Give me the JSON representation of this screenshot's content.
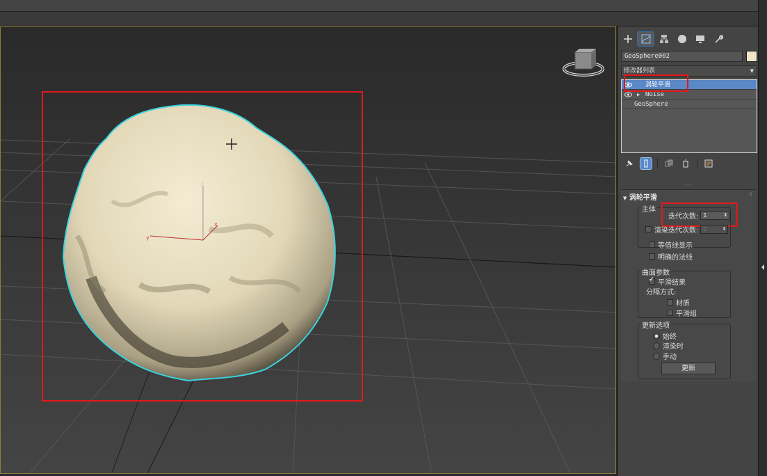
{
  "colors": {
    "highlight_red": "#e3181c",
    "selection_blue": "#5b88c6",
    "object_color": "#efe6c6",
    "wire_cyan": "#3ad3e0"
  },
  "viewport": {
    "cursor_icon": "crosshair-icon",
    "gizmo": {
      "axis_z": "z",
      "axis_x": "x",
      "axis_y": "y"
    },
    "viewcube_icon": "viewcube-icon"
  },
  "panel": {
    "tabs": [
      {
        "icon": "create-plus-icon"
      },
      {
        "icon": "modify-curve-icon"
      },
      {
        "icon": "hierarchy-icon"
      },
      {
        "icon": "motion-sphere-icon"
      },
      {
        "icon": "display-monitor-icon"
      },
      {
        "icon": "utilities-wrench-icon"
      }
    ],
    "object_name": "GeoSphere002",
    "modifier_list_label": "修改器列表",
    "stack": [
      {
        "label": "涡轮平滑",
        "selected": true
      },
      {
        "label": "Noise",
        "selected": false
      },
      {
        "label": "GeoSphere",
        "selected": false
      }
    ],
    "stack_tools": [
      "pin-stack-icon",
      "show-end-result-icon",
      "make-unique-icon",
      "remove-modifier-icon",
      "configure-sets-icon"
    ]
  },
  "rollout": {
    "title": "涡轮平滑",
    "main_group": "主体",
    "iterations_label": "迭代次数:",
    "iterations_value": "1",
    "render_iters_label": "渲染迭代次数:",
    "render_iters_value": "0",
    "isoline_label": "等值线显示",
    "explicit_normals_label": "明确的法线",
    "surface_group": "曲面参数",
    "smooth_result_label": "平滑结果",
    "separate_by_label": "分隔方式:",
    "materials_label": "材质",
    "smoothing_groups_label": "平滑组",
    "update_group": "更新选项",
    "always_label": "始终",
    "when_rendering_label": "渲染时",
    "manually_label": "手动",
    "update_button": "更新"
  }
}
